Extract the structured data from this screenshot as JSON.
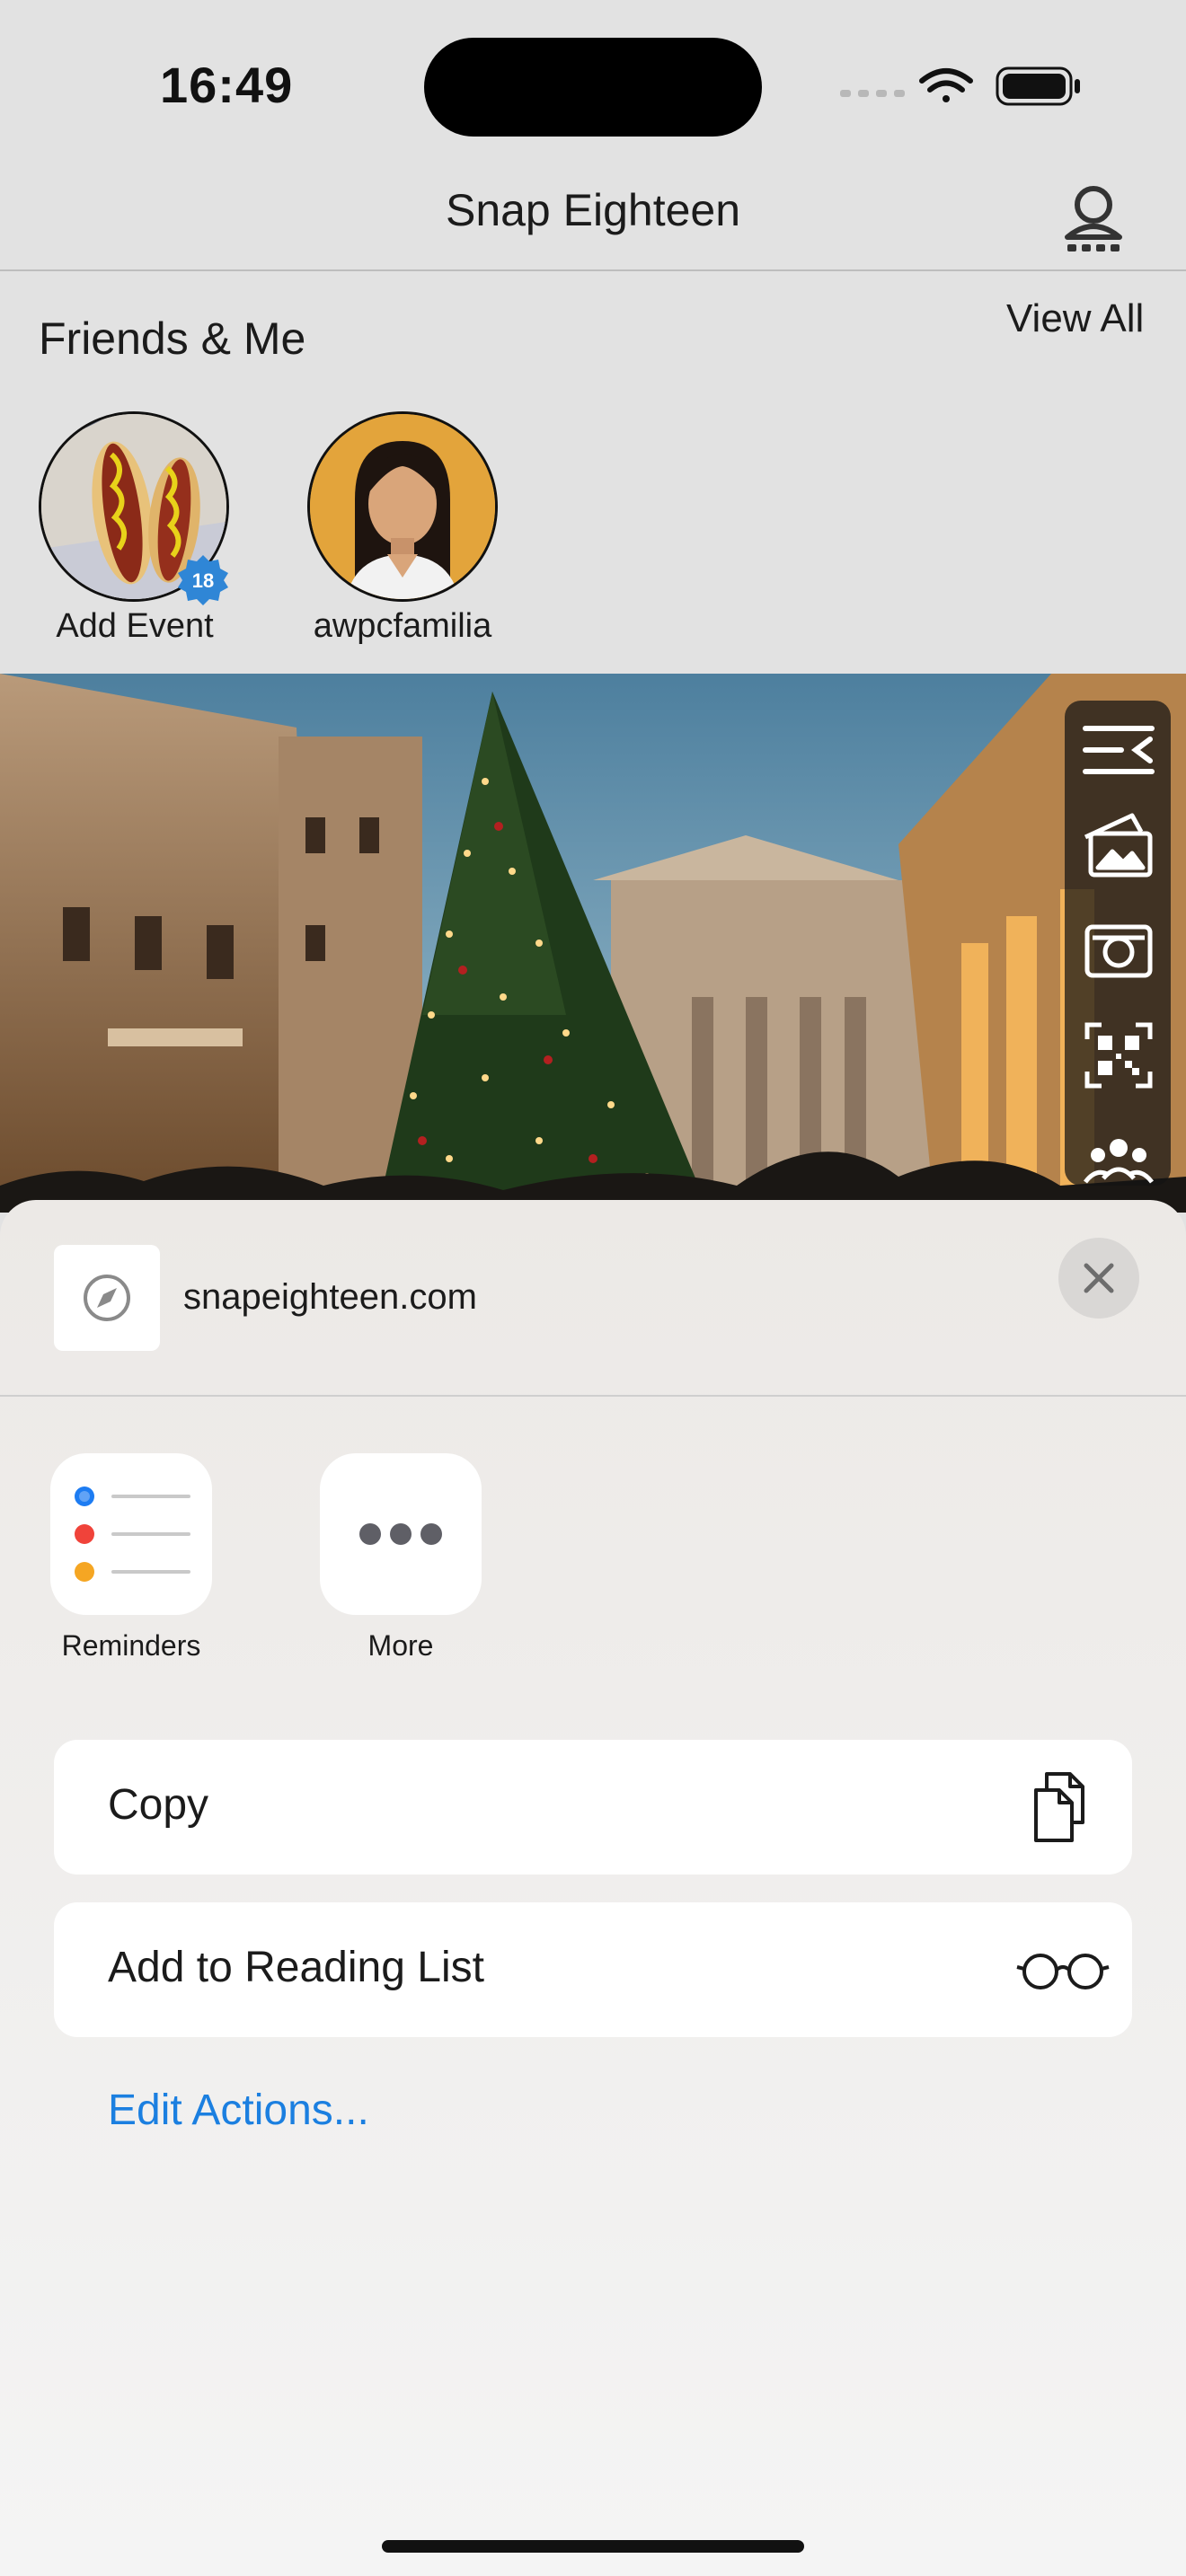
{
  "status_bar": {
    "time": "16:49"
  },
  "header": {
    "title": "Snap Eighteen"
  },
  "friends": {
    "title": "Friends & Me",
    "view_all": "View All",
    "items": [
      {
        "label": "Add Event",
        "badge": "18"
      },
      {
        "label": "awpcfamilia"
      }
    ]
  },
  "share_sheet": {
    "url": "snapeighteen.com",
    "apps": [
      {
        "label": "Reminders",
        "icon": "reminders-icon"
      },
      {
        "label": "More",
        "icon": "more-icon"
      }
    ],
    "actions": [
      {
        "label": "Copy",
        "icon": "copy-icon"
      },
      {
        "label": "Add to Reading List",
        "icon": "glasses-icon"
      }
    ],
    "edit_actions": "Edit Actions..."
  },
  "colors": {
    "accent": "#1b7fe0",
    "badge": "#2f86d6",
    "reminder_blue": "#1d7cf2",
    "reminder_red": "#f0433a",
    "reminder_orange": "#f5a623"
  }
}
